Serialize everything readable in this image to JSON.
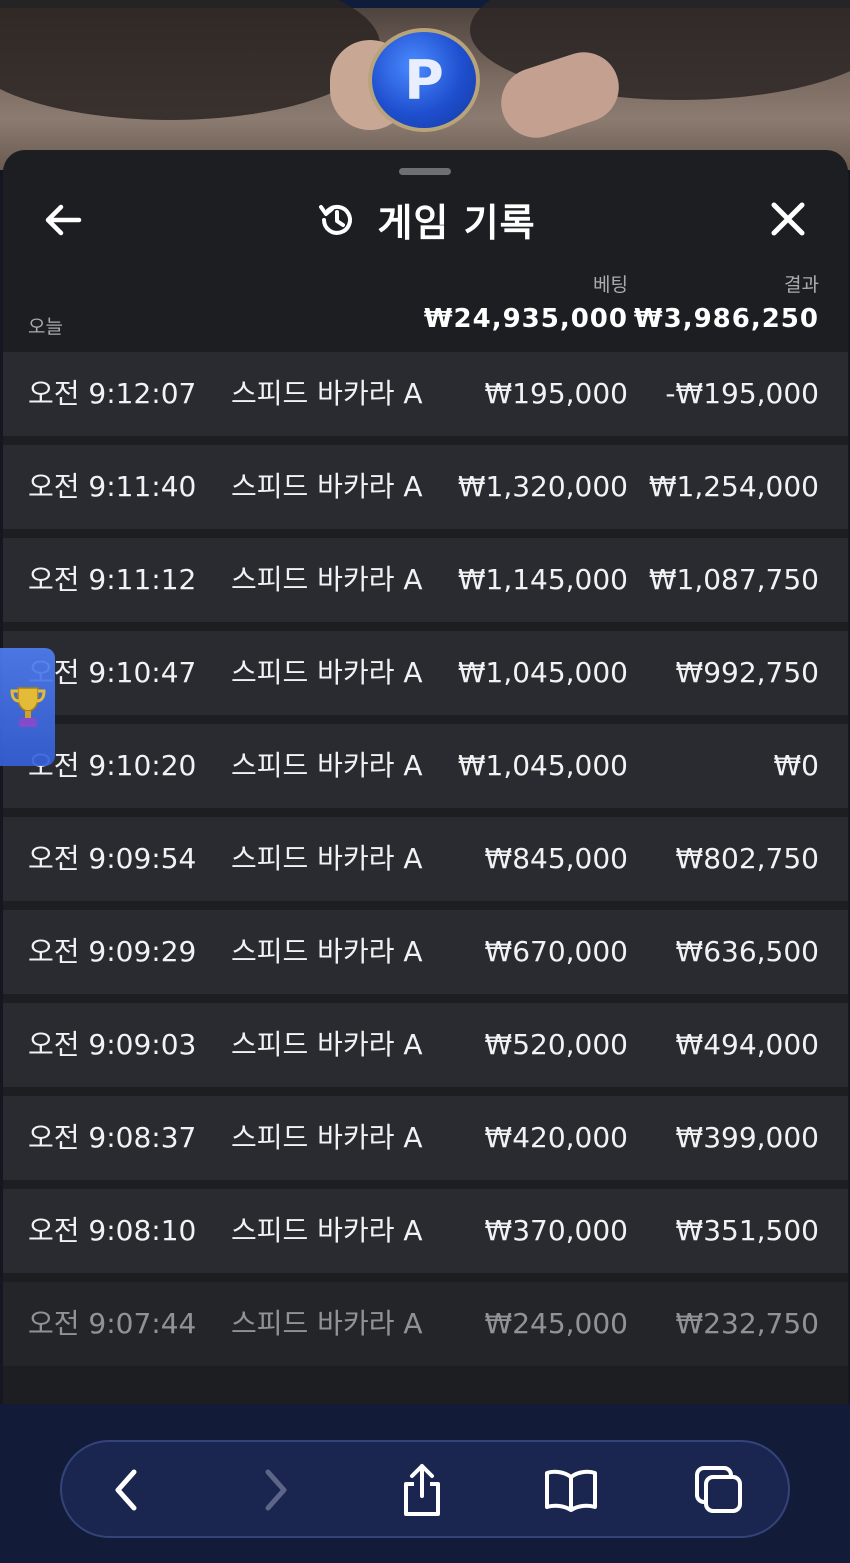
{
  "video": {
    "chip_letter": "P"
  },
  "sheet": {
    "title": "게임 기록",
    "columns": {
      "bet": "베팅",
      "result": "결과"
    },
    "summary": {
      "label": "오늘",
      "bet_total": "₩24,935,000",
      "result_total": "₩3,986,250"
    },
    "rows": [
      {
        "time": "오전 9:12:07",
        "game": "스피드 바카라 A",
        "bet": "₩195,000",
        "result": "-₩195,000"
      },
      {
        "time": "오전 9:11:40",
        "game": "스피드 바카라 A",
        "bet": "₩1,320,000",
        "result": "₩1,254,000"
      },
      {
        "time": "오전 9:11:12",
        "game": "스피드 바카라 A",
        "bet": "₩1,145,000",
        "result": "₩1,087,750"
      },
      {
        "time": "오전 9:10:47",
        "game": "스피드 바카라 A",
        "bet": "₩1,045,000",
        "result": "₩992,750"
      },
      {
        "time": "오전 9:10:20",
        "game": "스피드 바카라 A",
        "bet": "₩1,045,000",
        "result": "₩0"
      },
      {
        "time": "오전 9:09:54",
        "game": "스피드 바카라 A",
        "bet": "₩845,000",
        "result": "₩802,750"
      },
      {
        "time": "오전 9:09:29",
        "game": "스피드 바카라 A",
        "bet": "₩670,000",
        "result": "₩636,500"
      },
      {
        "time": "오전 9:09:03",
        "game": "스피드 바카라 A",
        "bet": "₩520,000",
        "result": "₩494,000"
      },
      {
        "time": "오전 9:08:37",
        "game": "스피드 바카라 A",
        "bet": "₩420,000",
        "result": "₩399,000"
      },
      {
        "time": "오전 9:08:10",
        "game": "스피드 바카라 A",
        "bet": "₩370,000",
        "result": "₩351,500"
      },
      {
        "time": "오전 9:07:44",
        "game": "스피드 바카라 A",
        "bet": "₩245,000",
        "result": "₩232,750"
      }
    ]
  },
  "icons": {
    "back": "arrow-left-icon",
    "history": "history-clock-icon",
    "close": "close-icon",
    "trophy": "trophy-icon",
    "browser_back": "chevron-left-icon",
    "browser_forward": "chevron-right-icon",
    "share": "share-icon",
    "bookmarks": "book-icon",
    "tabs": "tabs-icon"
  },
  "colors": {
    "sheet_bg": "#1d1e22",
    "row_bg": "#2a2b30",
    "muted_text": "#a9abb1",
    "toolbar_bg": "#1b2650",
    "trophy_tab": "#3f6ce6"
  }
}
